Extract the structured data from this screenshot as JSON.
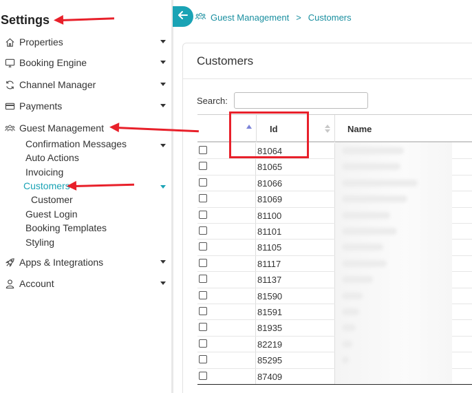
{
  "sidebar": {
    "title": "Settings",
    "items": [
      {
        "label": "Properties",
        "icon": "home-icon"
      },
      {
        "label": "Booking Engine",
        "icon": "monitor-icon"
      },
      {
        "label": "Channel Manager",
        "icon": "sync-icon"
      },
      {
        "label": "Payments",
        "icon": "credit-card-icon"
      },
      {
        "label": "Guest Management",
        "icon": "users-icon"
      },
      {
        "label": "Apps & Integrations",
        "icon": "rocket-icon"
      },
      {
        "label": "Account",
        "icon": "user-icon"
      }
    ],
    "guest_management_sub": [
      "Confirmation Messages",
      "Auto Actions",
      "Invoicing",
      "Customers",
      "Customer",
      "Guest Login",
      "Booking Templates",
      "Styling"
    ]
  },
  "breadcrumb": {
    "section": "Guest Management",
    "separator": ">",
    "page": "Customers"
  },
  "panel": {
    "title": "Customers",
    "search_label": "Search:",
    "search_value": ""
  },
  "table": {
    "columns": [
      "",
      "Id",
      "Name"
    ],
    "ids": [
      "81064",
      "81065",
      "81066",
      "81069",
      "81100",
      "81101",
      "81105",
      "81117",
      "81137",
      "81590",
      "81591",
      "81935",
      "82219",
      "85295",
      "87409"
    ]
  },
  "colors": {
    "accent": "#1aa3b5",
    "annotation_red": "#e8202a"
  }
}
